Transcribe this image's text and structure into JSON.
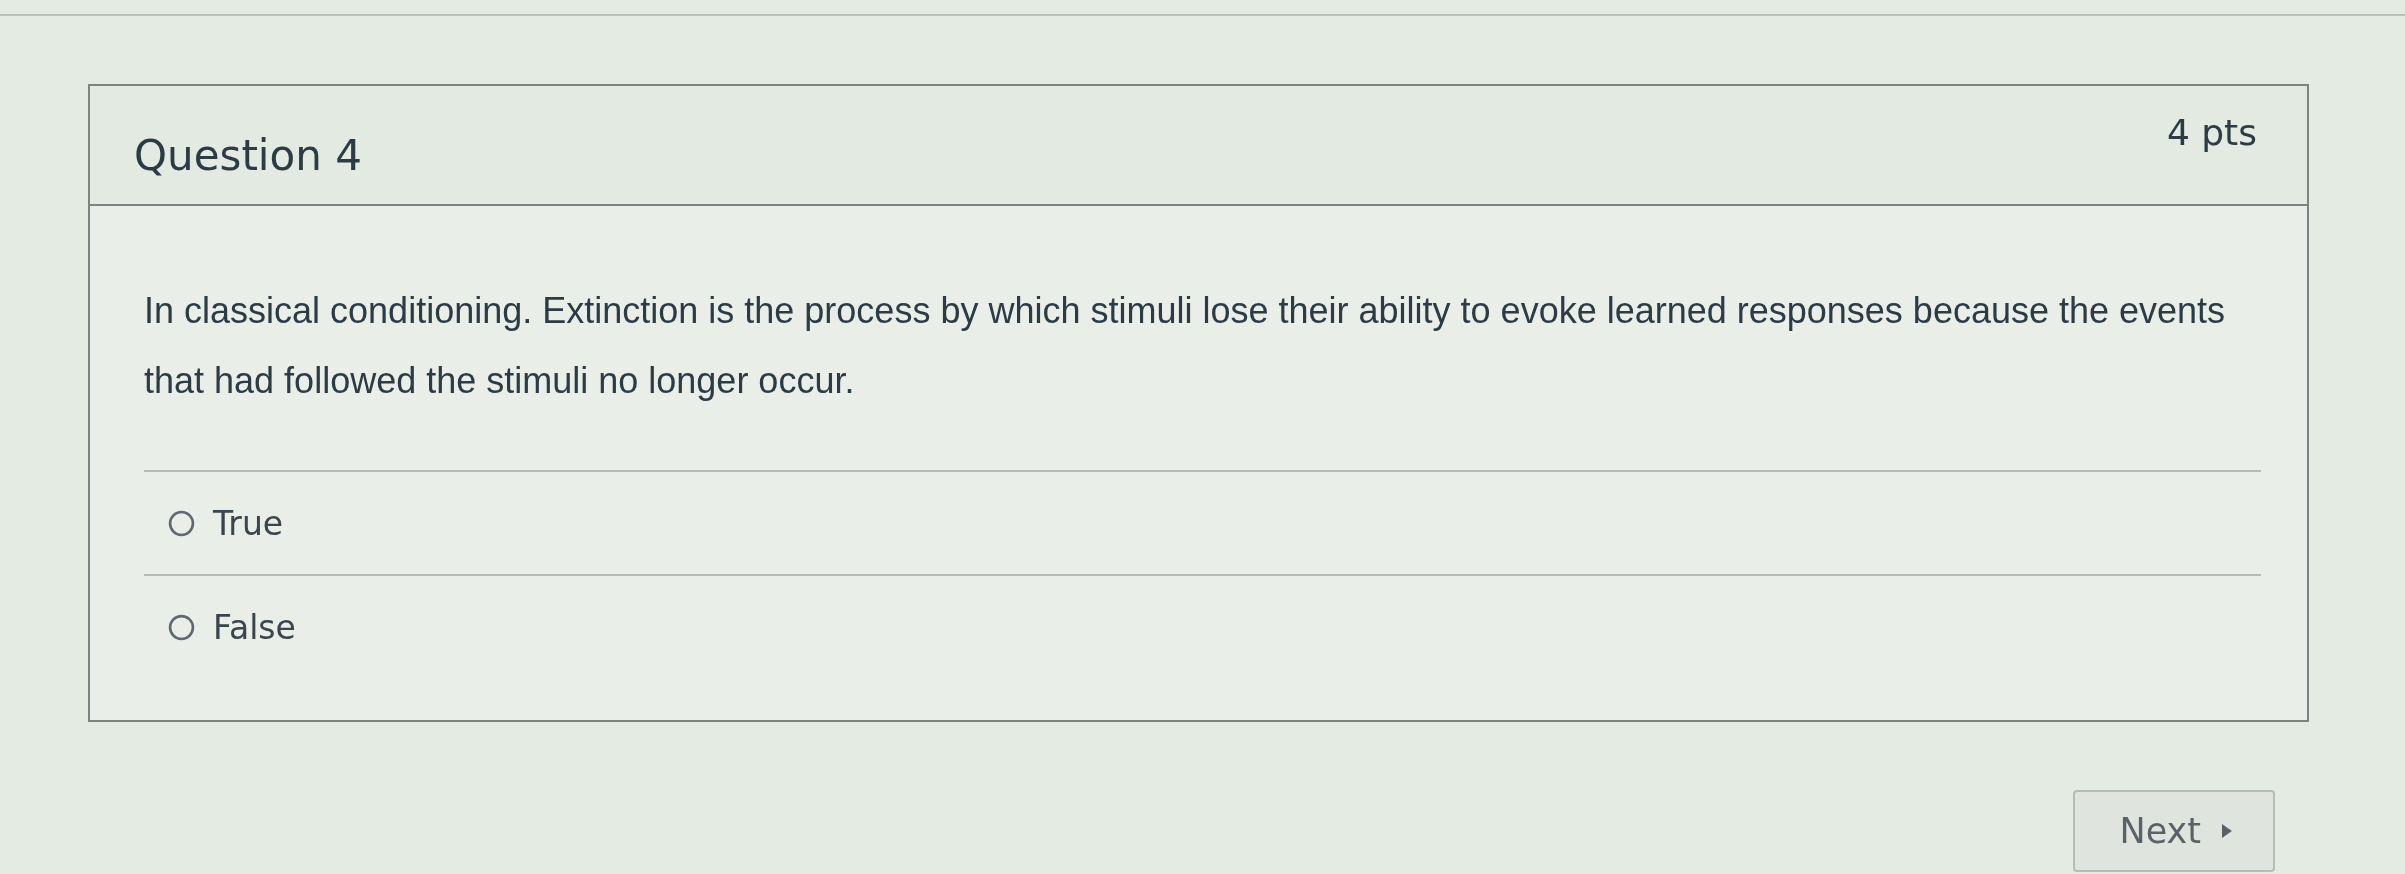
{
  "question": {
    "title": "Question 4",
    "points": "4 pts",
    "text": "In classical conditioning. Extinction is the process by which stimuli lose their ability to evoke learned responses because the events that had followed the stimuli no longer occur.",
    "answers": [
      {
        "label": "True",
        "selected": false
      },
      {
        "label": "False",
        "selected": false
      }
    ]
  },
  "next_button": {
    "label": "Next"
  }
}
